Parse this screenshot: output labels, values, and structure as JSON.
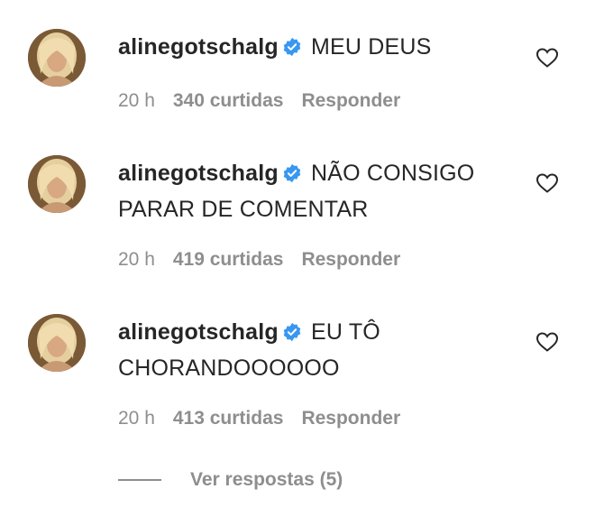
{
  "comments": [
    {
      "username": "alinegotschalg",
      "text": "MEU DEUS",
      "time": "20 h",
      "likes": "340 curtidas",
      "reply_label": "Responder"
    },
    {
      "username": "alinegotschalg",
      "text": "NÃO CONSIGO PARAR DE COMENTAR",
      "time": "20 h",
      "likes": "419 curtidas",
      "reply_label": "Responder"
    },
    {
      "username": "alinegotschalg",
      "text": "EU TÔ CHORANDOOOOOO",
      "time": "20 h",
      "likes": "413 curtidas",
      "reply_label": "Responder"
    }
  ],
  "view_replies_label": "Ver respostas (5)",
  "icons": {
    "verified": "verified-badge-icon",
    "like": "heart-outline-icon"
  },
  "colors": {
    "text": "#262626",
    "secondary": "#8e8e8e",
    "verified_blue": "#3897f0"
  }
}
